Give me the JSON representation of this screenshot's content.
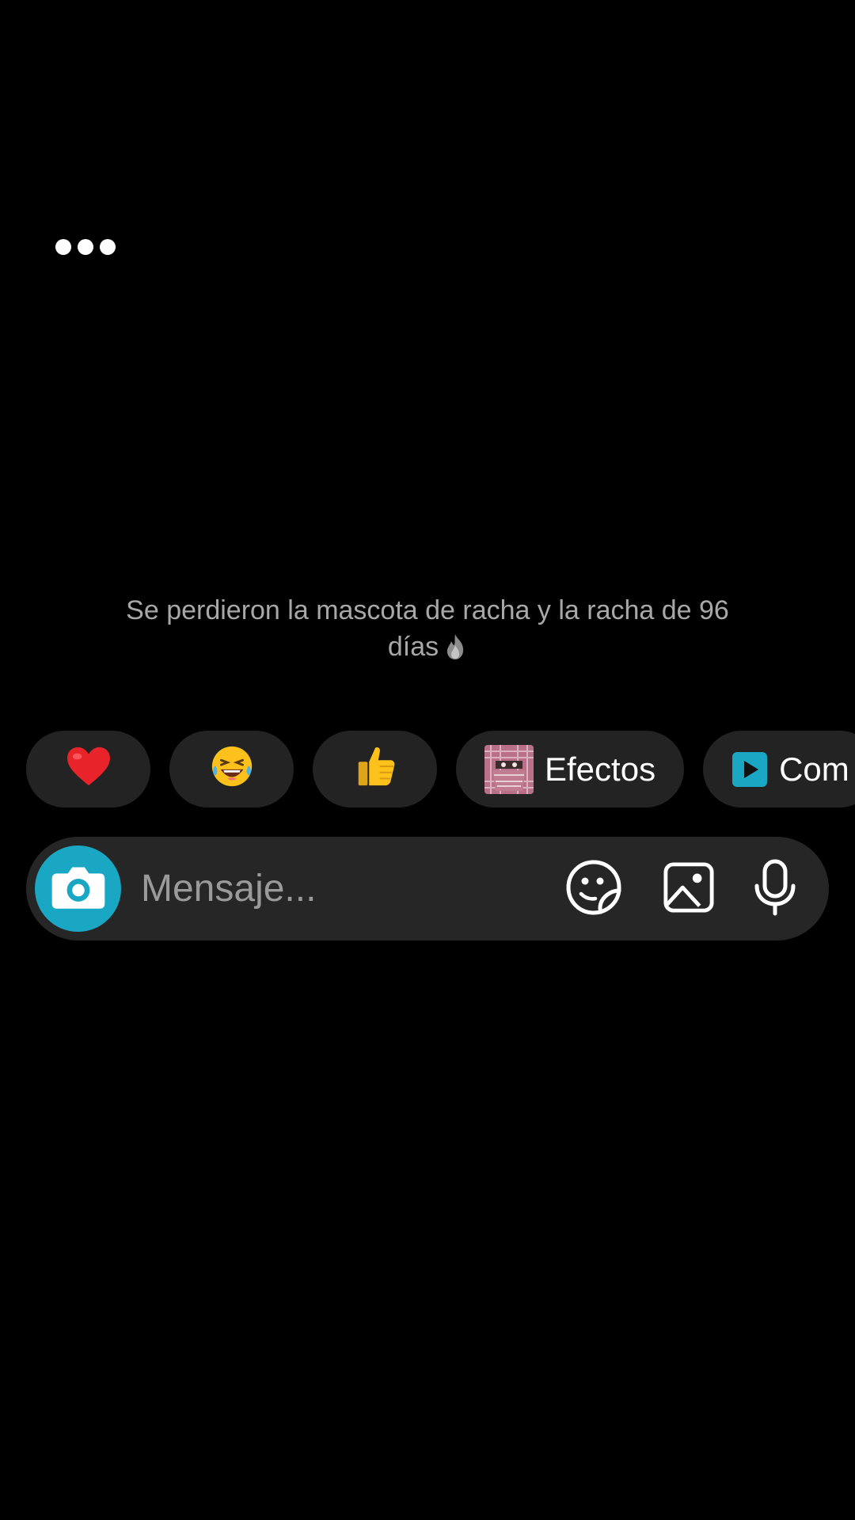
{
  "notice": {
    "text": "Se perdieron la mascota de racha y la racha de 96 días",
    "icon": "fire-icon"
  },
  "quick_replies": [
    {
      "type": "emoji",
      "glyph": "❤️",
      "icon": "heart-emoji"
    },
    {
      "type": "emoji",
      "glyph": "😂",
      "icon": "laughing-emoji"
    },
    {
      "type": "emoji",
      "glyph": "👍",
      "icon": "thumbs-up-emoji"
    },
    {
      "type": "labeled",
      "label": "Efectos",
      "icon": "effects-thumbnail"
    },
    {
      "type": "labeled",
      "label": "Com",
      "icon": "play-icon"
    }
  ],
  "composer": {
    "placeholder": "Mensaje...",
    "camera_icon": "camera-icon",
    "tools": [
      "sticker-icon",
      "gallery-icon",
      "microphone-icon"
    ]
  },
  "colors": {
    "background": "#000000",
    "chip": "#232323",
    "composer": "#262626",
    "accent": "#1aa7c4",
    "notice_text": "#a8a8a8"
  }
}
